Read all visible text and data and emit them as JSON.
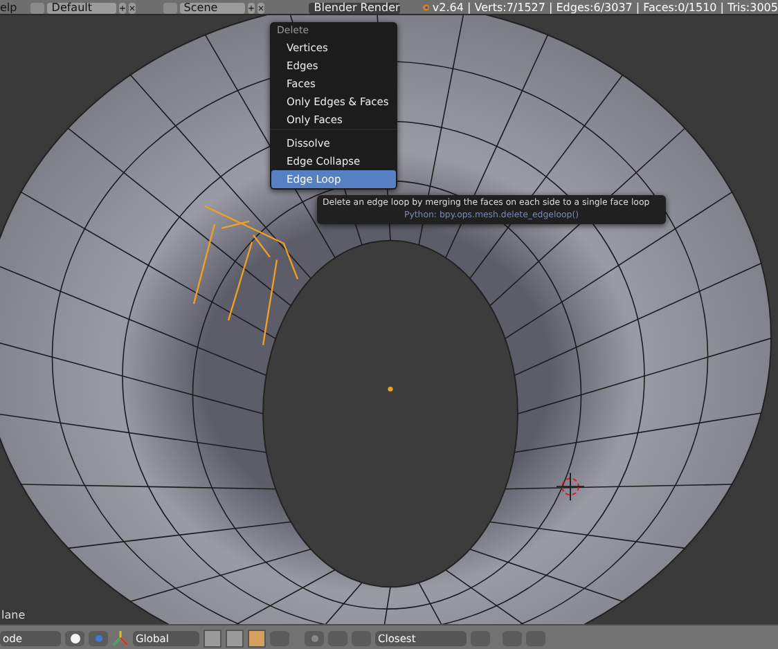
{
  "header": {
    "menu_label": "elp",
    "layout": "Default",
    "scene": "Scene",
    "renderer": "Blender Render",
    "stats": "v2.64 | Verts:7/1527 | Edges:6/3037 | Faces:0/1510 | Tris:3005"
  },
  "popup_menu": {
    "title": "Delete",
    "items": [
      {
        "label": "Vertices",
        "selected": false,
        "separator_before": false
      },
      {
        "label": "Edges",
        "selected": false,
        "separator_before": false
      },
      {
        "label": "Faces",
        "selected": false,
        "separator_before": false
      },
      {
        "label": "Only Edges & Faces",
        "selected": false,
        "separator_before": false
      },
      {
        "label": "Only Faces",
        "selected": false,
        "separator_before": false
      },
      {
        "label": "Dissolve",
        "selected": false,
        "separator_before": true
      },
      {
        "label": "Edge Collapse",
        "selected": false,
        "separator_before": false
      },
      {
        "label": "Edge Loop",
        "selected": true,
        "separator_before": false
      }
    ]
  },
  "tooltip": {
    "text": "Delete an edge loop by merging the faces on each side to a single face loop",
    "python": "Python: bpy.ops.mesh.delete_edgeloop()"
  },
  "viewport": {
    "object_label": "lane"
  },
  "footer": {
    "mode": "ode",
    "orientation": "Global",
    "snap_target": "Closest"
  }
}
